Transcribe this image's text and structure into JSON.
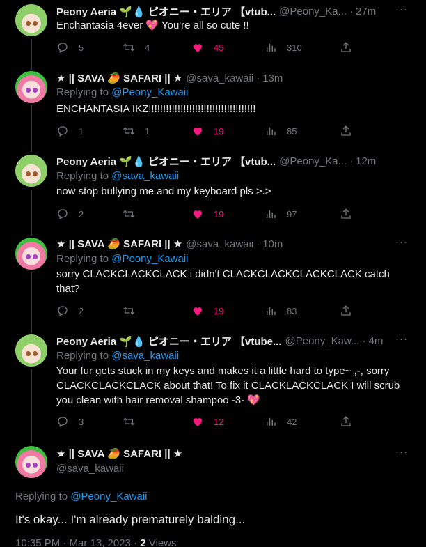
{
  "tweets": [
    {
      "name": "Peony Aeria 🌱💧 ピオニー・エリア 【vtub...",
      "handle": "@Peony_Ka...",
      "time": "27m",
      "replying_to": "",
      "text": "Enchantasia 4ever 💖 You're all so cute !!",
      "replies": "5",
      "retweets": "4",
      "likes": "45",
      "views": "310",
      "liked": true
    },
    {
      "name": "★ || SAVA 🥭 SAFARI || ★",
      "handle": "@sava_kawaii",
      "time": "13m",
      "replying_label": "Replying to",
      "replying_to": "@Peony_Kawaii",
      "text": "ENCHANTASIA IKZ!!!!!!!!!!!!!!!!!!!!!!!!!!!!!!!!!!!!!",
      "replies": "1",
      "retweets": "1",
      "likes": "19",
      "views": "85",
      "liked": true
    },
    {
      "name": "Peony Aeria 🌱💧 ピオニー・エリア 【vtub...",
      "handle": "@Peony_Ka...",
      "time": "12m",
      "replying_label": "Replying to",
      "replying_to": "@sava_kawaii",
      "text": "now stop bullying me and my keyboard pls >.>",
      "replies": "2",
      "retweets": "",
      "likes": "19",
      "views": "97",
      "liked": true
    },
    {
      "name": "★ || SAVA 🥭 SAFARI || ★",
      "handle": "@sava_kawaii",
      "time": "10m",
      "replying_label": "Replying to",
      "replying_to": "@Peony_Kawaii",
      "text": "sorry CLACKCLACKCLACK i didn't CLACKCLACKCLACKCLACK catch that?",
      "replies": "2",
      "retweets": "",
      "likes": "19",
      "views": "83",
      "liked": true
    },
    {
      "name": "Peony Aeria 🌱💧 ピオニー・エリア 【vtube...",
      "handle": "@Peony_Kaw...",
      "time": "4m",
      "replying_label": "Replying to",
      "replying_to": "@sava_kawaii",
      "text": "Your fur gets stuck in my keys and makes it a little hard to type~ ,-, sorry CLACKCLACKCLACK about that! To fix it CLACKLACKCLACK I will scrub you clean with hair removal shampoo -3- 💖",
      "replies": "3",
      "retweets": "",
      "likes": "12",
      "views": "42",
      "liked": true
    }
  ],
  "main_tweet": {
    "name": "★ || SAVA 🥭 SAFARI || ★",
    "handle": "@sava_kawaii",
    "replying_label": "Replying to",
    "replying_to": "@Peony_Kawaii",
    "text": "It's okay... I'm already prematurely balding...",
    "timestamp": "10:35 PM · Mar 13, 2023 · ",
    "views_count": "2",
    "views_label": " Views"
  },
  "colors": {
    "background": "#000000",
    "text": "#e7e9ea",
    "muted": "#71767b",
    "link": "#1d9bf0",
    "like": "#f91880",
    "thread_line": "#333639"
  },
  "icons": [
    "reply-icon",
    "retweet-icon",
    "like-icon",
    "views-icon",
    "share-icon",
    "more-icon"
  ],
  "dot": "·",
  "more_glyph": "···"
}
